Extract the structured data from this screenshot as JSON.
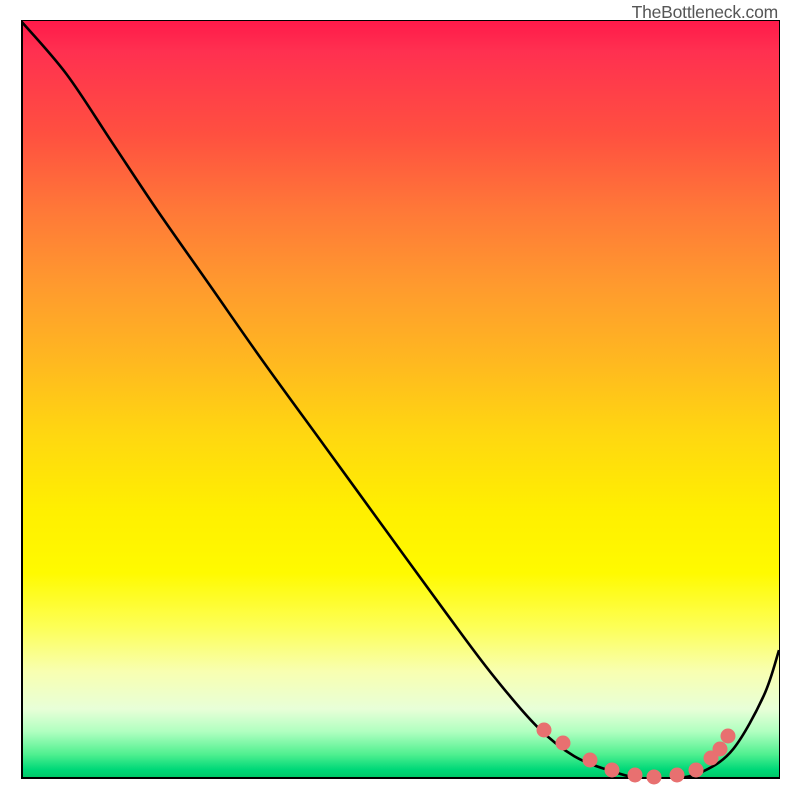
{
  "watermark": "TheBottleneck.com",
  "chart_data": {
    "type": "line",
    "title": "",
    "xlabel": "",
    "ylabel": "",
    "xlim": [
      0,
      100
    ],
    "ylim": [
      0,
      100
    ],
    "series": [
      {
        "name": "bottleneck-curve",
        "x": [
          0,
          6,
          12,
          18,
          25,
          32,
          40,
          48,
          56,
          62,
          68,
          73,
          78,
          82,
          86,
          90,
          94,
          98,
          100
        ],
        "values": [
          100,
          93,
          84,
          75,
          65,
          55,
          44,
          33,
          22,
          14,
          7,
          3,
          1,
          0,
          0,
          1,
          4,
          11,
          17
        ]
      }
    ],
    "markers": {
      "name": "optimal-range-dots",
      "x": [
        69.0,
        71.5,
        75.0,
        78.0,
        81.0,
        83.5,
        86.5,
        89.0,
        91.0,
        92.2,
        93.3
      ],
      "values": [
        6.5,
        4.7,
        2.5,
        1.2,
        0.5,
        0.3,
        0.5,
        1.2,
        2.8,
        4.0,
        5.7
      ]
    },
    "gradient_description": "vertical red-to-green heatmap background indicating bottleneck severity"
  }
}
